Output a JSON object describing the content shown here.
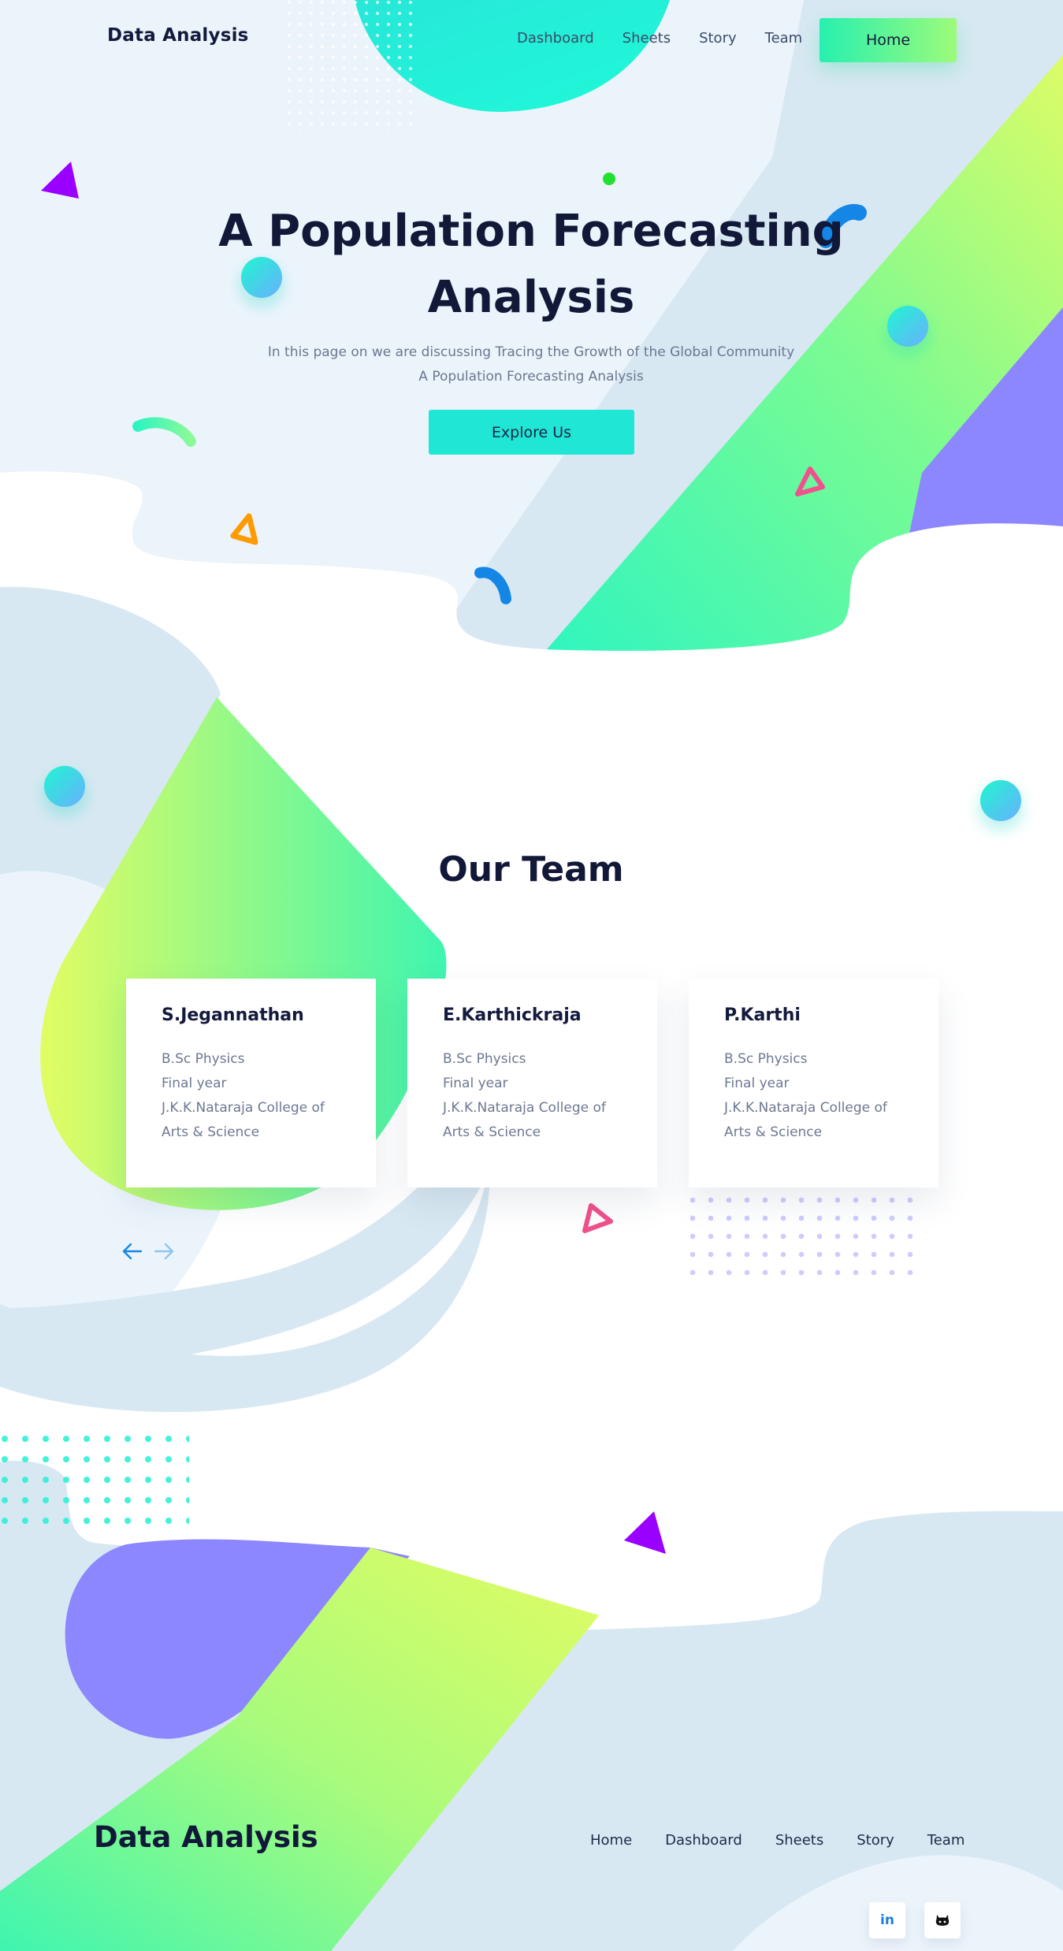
{
  "header": {
    "brand": "Data Analysis",
    "nav": [
      "Dashboard",
      "Sheets",
      "Story",
      "Team"
    ],
    "home_button": "Home"
  },
  "hero": {
    "title_line1": "A Population Forecasting",
    "title_line2": "Analysis",
    "subtitle_line1": "In this page on we are discussing Tracing the Growth of the Global Community",
    "subtitle_line2": "A Population Forecasting Analysis",
    "cta": "Explore Us"
  },
  "team": {
    "title": "Our Team",
    "members": [
      {
        "name": "S.Jegannathan",
        "degree": "B.Sc Physics",
        "year": "Final year",
        "college_line1": "J.K.K.Nataraja College of",
        "college_line2": "Arts & Science"
      },
      {
        "name": "E.Karthickraja",
        "degree": "B.Sc Physics",
        "year": "Final year",
        "college_line1": "J.K.K.Nataraja College of",
        "college_line2": "Arts & Science"
      },
      {
        "name": "P.Karthi",
        "degree": "B.Sc Physics",
        "year": "Final year",
        "college_line1": "J.K.K.Nataraja College of",
        "college_line2": "Arts & Science"
      }
    ],
    "prev_icon": "arrow-left-icon",
    "next_icon": "arrow-right-icon"
  },
  "footer": {
    "brand": "Data Analysis",
    "nav": [
      "Home",
      "Dashboard",
      "Sheets",
      "Story",
      "Team"
    ],
    "linkedin_label": "in",
    "social_icons": [
      "linkedin-icon",
      "github-icon"
    ]
  },
  "colors": {
    "navy_text": "#111838",
    "mint": "#27f0b0",
    "lime": "#d6fc6a",
    "cyan": "#20e6d6",
    "violet": "#8c86ff",
    "purple_accent": "#9a00ff",
    "pink_accent": "#f0508c",
    "pale_blue": "#d8e8f2"
  }
}
